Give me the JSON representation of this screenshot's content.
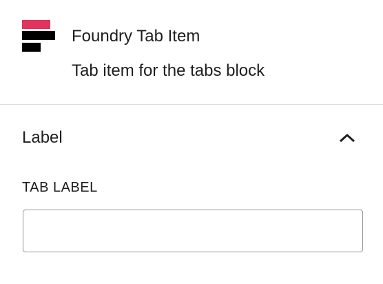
{
  "block": {
    "icon": "foundry-logo-icon",
    "title": "Foundry Tab Item",
    "description": "Tab item for the tabs block"
  },
  "panel": {
    "title": "Label",
    "toggle_icon": "chevron-up-icon",
    "expanded": true
  },
  "field": {
    "label": "TAB LABEL",
    "value": "",
    "placeholder": ""
  },
  "colors": {
    "accent": "#e0335d",
    "text": "#1e1e1e",
    "icon_dark": "#000000",
    "divider": "#dddddd",
    "input_border": "#949494"
  }
}
